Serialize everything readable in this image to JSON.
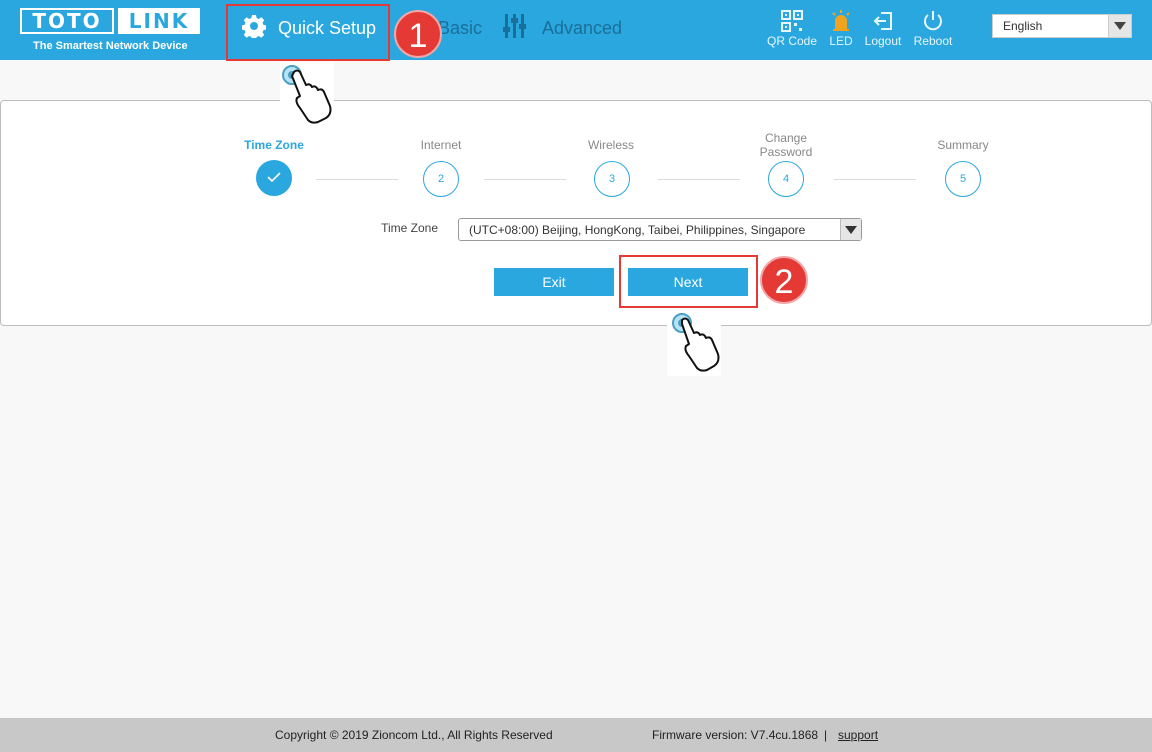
{
  "header": {
    "logo_left": "TOTO",
    "logo_right": "LINK",
    "logo_tagline": "The Smartest Network Device",
    "nav": {
      "quick_setup": "Quick Setup",
      "basic": "Basic",
      "advanced": "Advanced"
    },
    "tools": {
      "qr_code": "QR Code",
      "led": "LED",
      "logout": "Logout",
      "reboot": "Reboot"
    },
    "language": "English"
  },
  "wizard": {
    "steps": [
      {
        "label": "Time Zone",
        "number": "",
        "status": "done"
      },
      {
        "label": "Internet",
        "number": "2",
        "status": "pending"
      },
      {
        "label": "Wireless",
        "number": "3",
        "status": "pending"
      },
      {
        "label": "Change\nPassword",
        "number": "4",
        "status": "pending"
      },
      {
        "label": "Summary",
        "number": "5",
        "status": "pending"
      }
    ],
    "time_zone_label": "Time Zone",
    "time_zone_value": "(UTC+08:00) Beijing, HongKong, Taibei, Philippines, Singapore",
    "exit_label": "Exit",
    "next_label": "Next"
  },
  "annotations": {
    "badge_1": "1",
    "badge_2": "2"
  },
  "footer": {
    "copyright": "Copyright © 2019 Zioncom Ltd., All Rights Reserved",
    "firmware": "Firmware version: V7.4cu.1868",
    "separator": "|",
    "support": "support"
  },
  "colors": {
    "accent": "#2aa7df",
    "annotation": "#e53935"
  }
}
